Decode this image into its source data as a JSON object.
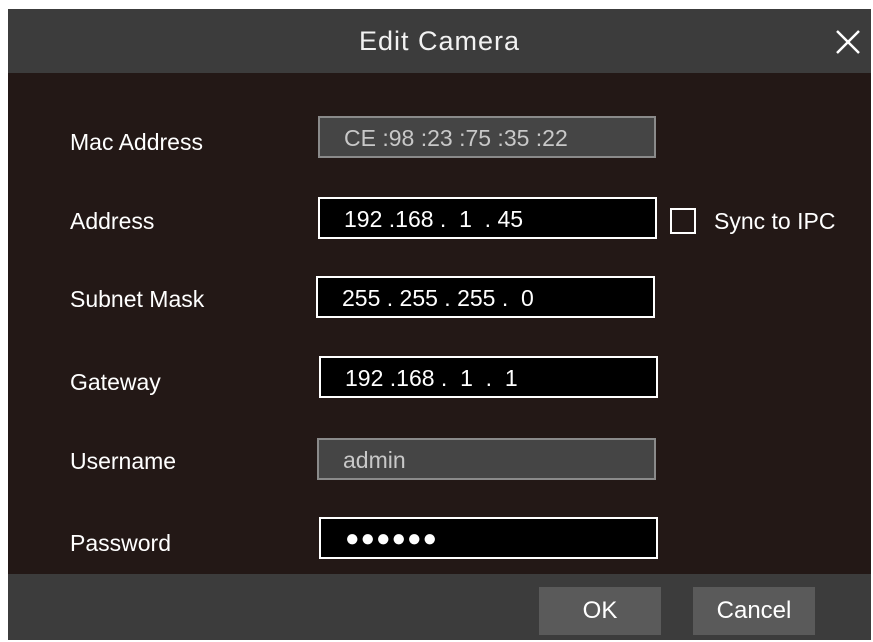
{
  "dialog": {
    "title": "Edit Camera",
    "close_icon": "close-icon"
  },
  "form": {
    "mac_address": {
      "label": "Mac Address",
      "value": "CE :98 :23 :75 :35 :22",
      "enabled": false
    },
    "address": {
      "label": "Address",
      "value": "192 .168 .  1  . 45",
      "enabled": true
    },
    "subnet_mask": {
      "label": "Subnet Mask",
      "value": "255 . 255 . 255 .  0",
      "enabled": true
    },
    "gateway": {
      "label": "Gateway",
      "value": "192 .168 .  1  .  1",
      "enabled": true
    },
    "username": {
      "label": "Username",
      "value": "admin",
      "enabled": false
    },
    "password": {
      "label": "Password",
      "value": "●●●●●●",
      "enabled": true
    }
  },
  "sync": {
    "label": "Sync to IPC",
    "checked": false
  },
  "buttons": {
    "ok": "OK",
    "cancel": "Cancel"
  },
  "colors": {
    "body_bg": "#231816",
    "bar_bg": "#3c3c3c",
    "button_bg": "#5a5a5a",
    "disabled_field_bg": "#454545"
  }
}
